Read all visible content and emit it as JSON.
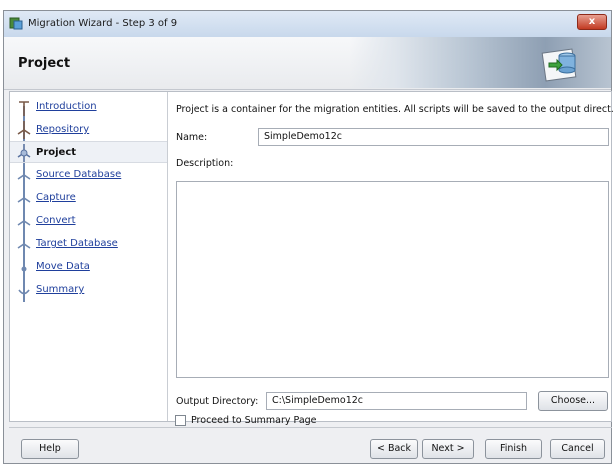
{
  "window": {
    "title": "Migration Wizard - Step 3 of 9",
    "close_label": "x"
  },
  "header": {
    "title": "Project"
  },
  "nav": {
    "items": [
      {
        "label": "Introduction",
        "icon": "step-done-icon",
        "current": false
      },
      {
        "label": "Repository",
        "icon": "step-done-icon",
        "current": false
      },
      {
        "label": "Project",
        "icon": "step-current-icon",
        "current": true
      },
      {
        "label": "Source Database",
        "icon": "step-icon",
        "current": false
      },
      {
        "label": "Capture ",
        "icon": "step-icon",
        "current": false
      },
      {
        "label": "Convert",
        "icon": "step-icon",
        "current": false
      },
      {
        "label": "Target Database",
        "icon": "step-icon",
        "current": false
      },
      {
        "label": "Move Data",
        "icon": "step-icon",
        "current": false
      },
      {
        "label": "Summary",
        "icon": "step-end-icon",
        "current": false
      }
    ]
  },
  "main": {
    "info": "Project is a container for the migration entities.  All scripts will be saved to the output direct...",
    "name_label": "Name:",
    "name_value": "SimpleDemo12c",
    "description_label": "Description:",
    "description_value": "",
    "output_dir_label": "Output Directory:",
    "output_dir_value": "C:\\SimpleDemo12c",
    "choose_label": "Choose...",
    "proceed_label": "Proceed to Summary Page",
    "proceed_checked": false
  },
  "footer": {
    "help_label": "Help",
    "back_label": "< Back",
    "next_label": "Next >",
    "finish_label": "Finish",
    "cancel_label": "Cancel"
  },
  "colors": {
    "link": "#1f3f9c",
    "close_button": "#c23a22",
    "title_bar": "#c8d8ec"
  }
}
